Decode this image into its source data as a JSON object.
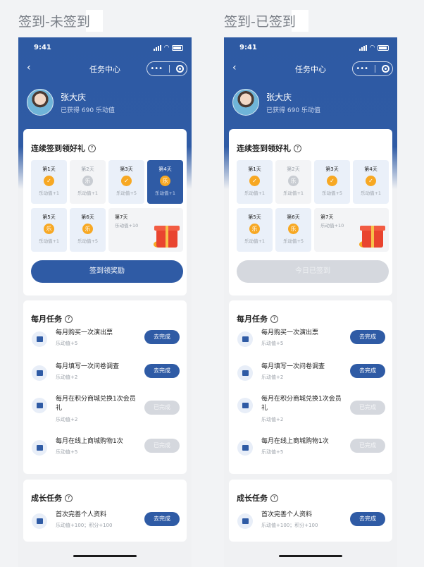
{
  "captions": {
    "left": "签到-未签到",
    "right": "签到-已签到"
  },
  "status": {
    "time": "9:41"
  },
  "nav": {
    "title": "任务中心",
    "back": "‹",
    "more": "•••"
  },
  "user": {
    "name": "张大庆",
    "points": "已获得 690 乐动值"
  },
  "checkin": {
    "title": "连续签到领好礼",
    "coin_char": "乐",
    "days_left": [
      {
        "label": "第1天",
        "reward": "乐动值+1",
        "state": "checked"
      },
      {
        "label": "第2天",
        "reward": "乐动值+1",
        "state": "missed"
      },
      {
        "label": "第3天",
        "reward": "乐动值+5",
        "state": "checked"
      },
      {
        "label": "第4天",
        "reward": "乐动值+1",
        "state": "today"
      },
      {
        "label": "第5天",
        "reward": "乐动值+1",
        "state": "future"
      },
      {
        "label": "第6天",
        "reward": "乐动值+5",
        "state": "future"
      }
    ],
    "days_right": [
      {
        "label": "第1天",
        "reward": "乐动值+1",
        "state": "checked"
      },
      {
        "label": "第2天",
        "reward": "乐动值+1",
        "state": "missed"
      },
      {
        "label": "第3天",
        "reward": "乐动值+5",
        "state": "checked"
      },
      {
        "label": "第4天",
        "reward": "乐动值+1",
        "state": "checked"
      },
      {
        "label": "第5天",
        "reward": "乐动值+1",
        "state": "future"
      },
      {
        "label": "第6天",
        "reward": "乐动值+5",
        "state": "future"
      }
    ],
    "day7": {
      "label": "第7天",
      "reward": "乐动值+10"
    },
    "button_left": "签到领奖励",
    "button_right": "今日已签到"
  },
  "monthly": {
    "title": "每月任务",
    "tasks": [
      {
        "title": "每月购买一次演出票",
        "points": "乐动值+5",
        "button": "去完成",
        "enabled": true
      },
      {
        "title": "每月填写一次问卷调查",
        "points": "乐动值+2",
        "button": "去完成",
        "enabled": true
      },
      {
        "title": "每月在积分商城兑换1次会员礼",
        "points": "乐动值+2",
        "button": "已完成",
        "enabled": false
      },
      {
        "title": "每月在线上商城购物1次",
        "points": "乐动值+5",
        "button": "已完成",
        "enabled": false
      }
    ]
  },
  "growth": {
    "title": "成长任务",
    "tasks": [
      {
        "title": "首次完善个人资料",
        "points": "乐动值+100；积分+100",
        "button": "去完成",
        "enabled": true
      }
    ]
  },
  "colors": {
    "primary": "#2f5ba5",
    "coin": "#f7a823",
    "disabled": "#d5d8de"
  }
}
